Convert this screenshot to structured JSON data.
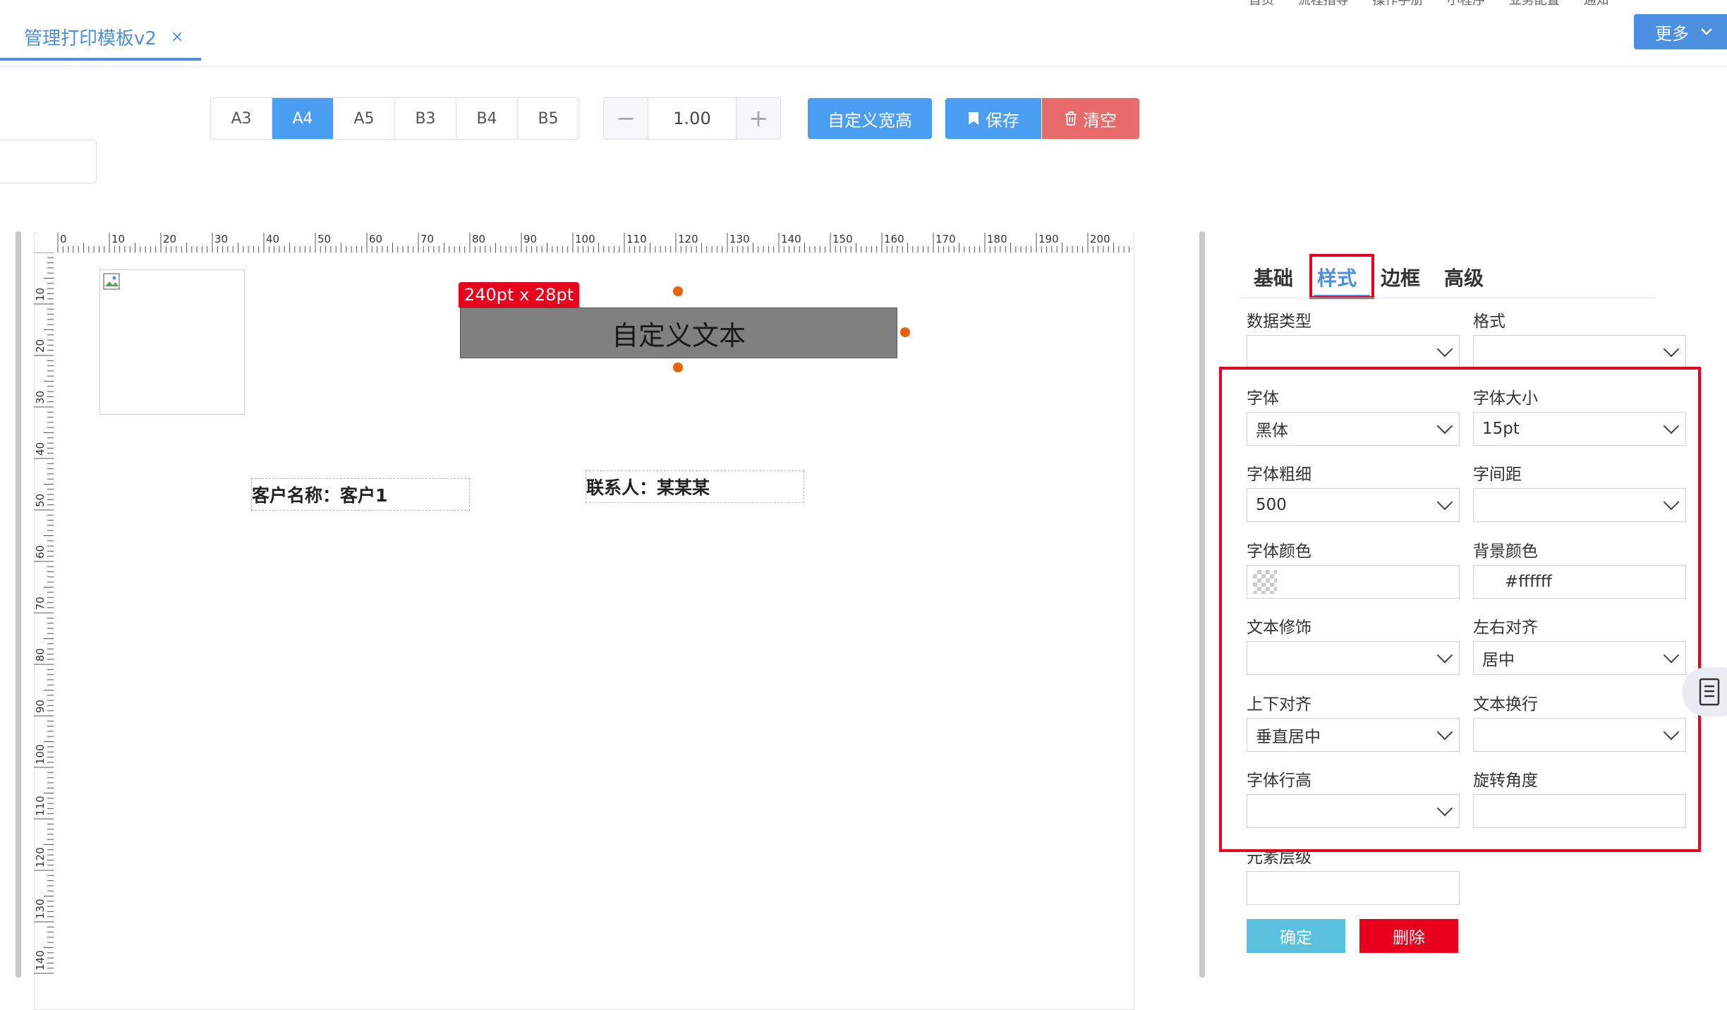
{
  "top_nav": [
    "首页",
    "流程指导",
    "操作手册",
    "小程序",
    "业务配置",
    "通知"
  ],
  "tab": {
    "title": "管理打印模板v2",
    "close": "×"
  },
  "more_button": "更多",
  "paper_sizes": {
    "items": [
      "A3",
      "A4",
      "A5",
      "B3",
      "B4",
      "B5"
    ],
    "active": "A4"
  },
  "zoom": {
    "minus": "−",
    "value": "1.00",
    "plus": "+"
  },
  "toolbar": {
    "custom_size": "自定义宽高",
    "save": "保存",
    "clear": "清空"
  },
  "ruler": {
    "h_labels": [
      "0",
      "10",
      "20",
      "30",
      "40",
      "50",
      "60",
      "70",
      "80",
      "90",
      "100",
      "110",
      "120",
      "130",
      "140",
      "150",
      "160",
      "170",
      "180",
      "190",
      "200"
    ],
    "v_labels": [
      "10",
      "20",
      "30",
      "40",
      "50",
      "60",
      "70",
      "80",
      "90",
      "100",
      "110",
      "120",
      "130",
      "140"
    ]
  },
  "canvas": {
    "selected_size_label": "240pt x 28pt",
    "selected_text": "自定义文本",
    "field_customer": "客户名称：客户1",
    "field_contact": "联系人：某某某"
  },
  "panel": {
    "tabs": [
      "基础",
      "样式",
      "边框",
      "高级"
    ],
    "active_tab": "样式",
    "fields": {
      "data_type": {
        "label": "数据类型",
        "value": ""
      },
      "format": {
        "label": "格式",
        "value": ""
      },
      "font": {
        "label": "字体",
        "value": "黑体"
      },
      "font_size": {
        "label": "字体大小",
        "value": "15pt"
      },
      "font_weight": {
        "label": "字体粗细",
        "value": "500"
      },
      "letter_spacing": {
        "label": "字间距",
        "value": ""
      },
      "font_color": {
        "label": "字体颜色",
        "value": ""
      },
      "bg_color": {
        "label": "背景颜色",
        "value": "#ffffff"
      },
      "text_decoration": {
        "label": "文本修饰",
        "value": ""
      },
      "h_align": {
        "label": "左右对齐",
        "value": "居中"
      },
      "v_align": {
        "label": "上下对齐",
        "value": "垂直居中"
      },
      "text_wrap": {
        "label": "文本换行",
        "value": ""
      },
      "line_height": {
        "label": "字体行高",
        "value": ""
      },
      "rotation": {
        "label": "旋转角度",
        "value": ""
      },
      "z_index": {
        "label": "元素层级",
        "value": ""
      }
    },
    "confirm": "确定",
    "delete": "删除"
  },
  "colors": {
    "primary": "#4a9ff5",
    "danger": "#e8001c",
    "clear_btn": "#e86a6a",
    "confirm_btn": "#5bc0de"
  }
}
